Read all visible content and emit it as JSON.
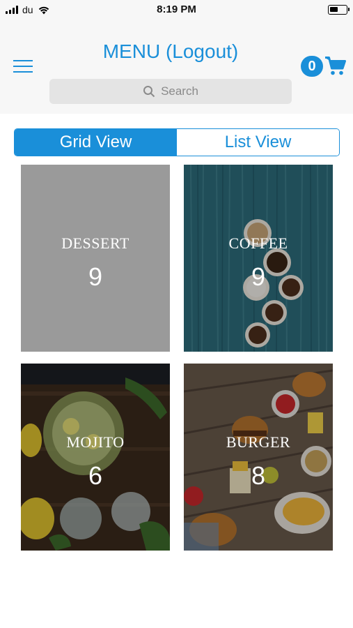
{
  "status_bar": {
    "carrier": "du",
    "time": "8:19 PM"
  },
  "header": {
    "title": "MENU (Logout)",
    "cart_count": "0",
    "search_placeholder": "Search"
  },
  "view_toggle": {
    "grid_label": "Grid View",
    "list_label": "List View",
    "selected": "grid"
  },
  "categories": [
    {
      "name": "DESSERT",
      "count": "9"
    },
    {
      "name": "COFFEE",
      "count": "9"
    },
    {
      "name": "MOJITO",
      "count": "6"
    },
    {
      "name": "BURGER",
      "count": "8"
    }
  ],
  "colors": {
    "accent": "#1a8fd9",
    "header_bg": "#f7f7f7",
    "search_bg": "#e4e4e4",
    "dessert_tile": "#9a9a9a"
  }
}
